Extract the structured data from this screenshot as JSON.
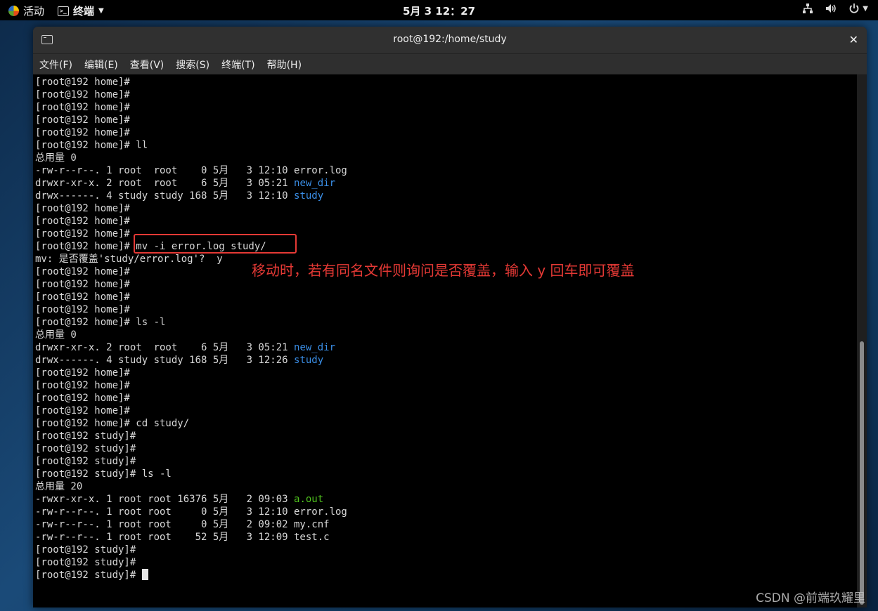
{
  "topbar": {
    "activities": "活动",
    "app_name": "终端",
    "clock": "5月 3  12：27",
    "icons": [
      "network-icon",
      "volume-icon",
      "power-icon"
    ]
  },
  "window": {
    "title": "root@192:/home/study",
    "close": "✕",
    "menu": [
      "文件(F)",
      "编辑(E)",
      "查看(V)",
      "搜索(S)",
      "终端(T)",
      "帮助(H)"
    ]
  },
  "terminal": {
    "lines": [
      [
        {
          "t": "[root@192 home]#"
        }
      ],
      [
        {
          "t": "[root@192 home]#"
        }
      ],
      [
        {
          "t": "[root@192 home]#"
        }
      ],
      [
        {
          "t": "[root@192 home]#"
        }
      ],
      [
        {
          "t": "[root@192 home]#"
        }
      ],
      [
        {
          "t": "[root@192 home]# ll"
        }
      ],
      [
        {
          "t": "总用量 0"
        }
      ],
      [
        {
          "t": "-rw-r--r--. 1 root  root    0 5月   3 12:10 error.log"
        }
      ],
      [
        {
          "t": "drwxr-xr-x. 2 root  root    6 5月   3 05:21 "
        },
        {
          "t": "new_dir",
          "c": "blue"
        }
      ],
      [
        {
          "t": "drwx------. 4 study study 168 5月   3 12:10 "
        },
        {
          "t": "study",
          "c": "blue"
        }
      ],
      [
        {
          "t": "[root@192 home]#"
        }
      ],
      [
        {
          "t": "[root@192 home]#"
        }
      ],
      [
        {
          "t": "[root@192 home]#"
        }
      ],
      [
        {
          "t": "[root@192 home]# mv -i error.log study/"
        }
      ],
      [
        {
          "t": "mv: 是否覆盖'study/error.log'?  y"
        }
      ],
      [
        {
          "t": "[root@192 home]#"
        }
      ],
      [
        {
          "t": "[root@192 home]#"
        }
      ],
      [
        {
          "t": "[root@192 home]#"
        }
      ],
      [
        {
          "t": "[root@192 home]#"
        }
      ],
      [
        {
          "t": "[root@192 home]# ls -l"
        }
      ],
      [
        {
          "t": "总用量 0"
        }
      ],
      [
        {
          "t": "drwxr-xr-x. 2 root  root    6 5月   3 05:21 "
        },
        {
          "t": "new_dir",
          "c": "blue"
        }
      ],
      [
        {
          "t": "drwx------. 4 study study 168 5月   3 12:26 "
        },
        {
          "t": "study",
          "c": "blue"
        }
      ],
      [
        {
          "t": "[root@192 home]#"
        }
      ],
      [
        {
          "t": "[root@192 home]#"
        }
      ],
      [
        {
          "t": "[root@192 home]#"
        }
      ],
      [
        {
          "t": "[root@192 home]#"
        }
      ],
      [
        {
          "t": "[root@192 home]# cd study/"
        }
      ],
      [
        {
          "t": "[root@192 study]#"
        }
      ],
      [
        {
          "t": "[root@192 study]#"
        }
      ],
      [
        {
          "t": "[root@192 study]#"
        }
      ],
      [
        {
          "t": "[root@192 study]# ls -l"
        }
      ],
      [
        {
          "t": "总用量 20"
        }
      ],
      [
        {
          "t": "-rwxr-xr-x. 1 root root 16376 5月   2 09:03 "
        },
        {
          "t": "a.out",
          "c": "green"
        }
      ],
      [
        {
          "t": "-rw-r--r--. 1 root root     0 5月   3 12:10 error.log"
        }
      ],
      [
        {
          "t": "-rw-r--r--. 1 root root     0 5月   2 09:02 my.cnf"
        }
      ],
      [
        {
          "t": "-rw-r--r--. 1 root root    52 5月   3 12:09 test.c"
        }
      ],
      [
        {
          "t": "[root@192 study]#"
        }
      ],
      [
        {
          "t": "[root@192 study]#"
        }
      ],
      [
        {
          "t": "[root@192 study]# "
        }
      ]
    ]
  },
  "annotation": "移动时，若有同名文件则询问是否覆盖，输入 y 回车即可覆盖",
  "watermark": "CSDN @前端玖耀里",
  "colors": {
    "accent_blue": "#3a8ee6",
    "accent_green": "#4fc11e",
    "annotation_red": "#e53935"
  }
}
